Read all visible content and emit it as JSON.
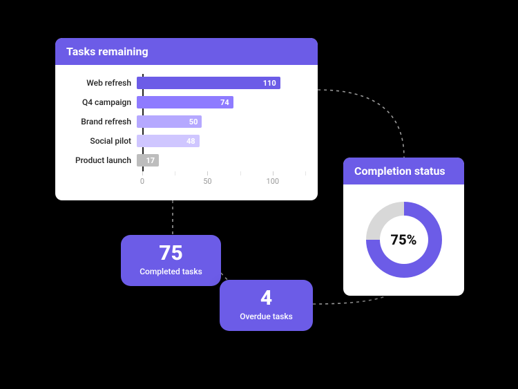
{
  "tasks_card": {
    "title": "Tasks remaining"
  },
  "completion_card": {
    "title": "Completion status",
    "percent_label": "75%",
    "percent": 75
  },
  "kpi_completed": {
    "value": "75",
    "label": "Completed tasks"
  },
  "kpi_overdue": {
    "value": "4",
    "label": "Overdue tasks"
  },
  "colors": {
    "accent": "#6C5CE7",
    "accent_light1": "#8E7BFF",
    "accent_light2": "#B5A8FF",
    "accent_light3": "#CFC6FF",
    "gray": "#BDBDBD",
    "donut_track": "#D8D8D8"
  },
  "chart_data": {
    "type": "bar",
    "title": "Tasks remaining",
    "xlabel": "",
    "ylabel": "",
    "xlim": [
      0,
      125
    ],
    "ticks": [
      0,
      50,
      100
    ],
    "categories": [
      "Web refresh",
      "Q4 campaign",
      "Brand refresh",
      "Social pilot",
      "Product launch"
    ],
    "values": [
      110,
      74,
      50,
      48,
      17
    ],
    "bar_colors": [
      "#6C5CE7",
      "#8E7BFF",
      "#B5A8FF",
      "#CFC6FF",
      "#BDBDBD"
    ]
  }
}
